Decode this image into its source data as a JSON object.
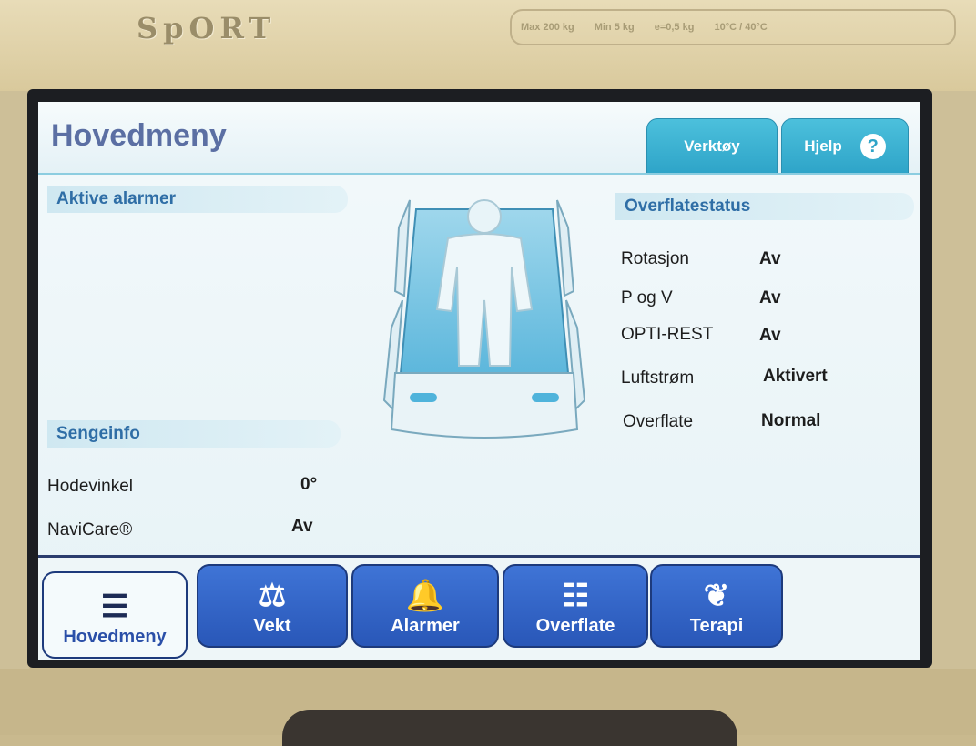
{
  "device": {
    "brand": "SpORT",
    "specs": [
      "Max 200 kg",
      "Min 5 kg",
      "e=0,5 kg",
      "10°C / 40°C"
    ]
  },
  "header": {
    "title": "Hovedmeny",
    "tools_label": "Verktøy",
    "help_label": "Hjelp",
    "help_icon": "?"
  },
  "alarms": {
    "title": "Aktive alarmer"
  },
  "bed_info": {
    "title": "Sengeinfo",
    "rows": [
      {
        "label": "Hodevinkel",
        "value": "0°"
      },
      {
        "label": "NaviCare®",
        "value": "Av"
      }
    ]
  },
  "surface_status": {
    "title": "Overflatestatus",
    "rows": [
      {
        "label": "Rotasjon",
        "value": "Av"
      },
      {
        "label": "P og V",
        "value": "Av"
      },
      {
        "label": "OPTI-REST",
        "value": "Av"
      },
      {
        "label": "Luftstrøm",
        "value": "Aktivert"
      },
      {
        "label": "Overflate",
        "value": "Normal"
      }
    ]
  },
  "nav": {
    "tabs": [
      {
        "label": "Hovedmeny",
        "icon": "list-icon",
        "glyph": "☰",
        "active": true
      },
      {
        "label": "Vekt",
        "icon": "scale-icon",
        "glyph": "⚖",
        "active": false
      },
      {
        "label": "Alarmer",
        "icon": "bell-icon",
        "glyph": "🔔",
        "active": false
      },
      {
        "label": "Overflate",
        "icon": "surface-icon",
        "glyph": "☷",
        "active": false
      },
      {
        "label": "Terapi",
        "icon": "lungs-icon",
        "glyph": "❦",
        "active": false
      }
    ]
  },
  "colors": {
    "accent": "#2ea4c8",
    "nav_blue": "#2957b8",
    "title": "#5b6fa3"
  }
}
